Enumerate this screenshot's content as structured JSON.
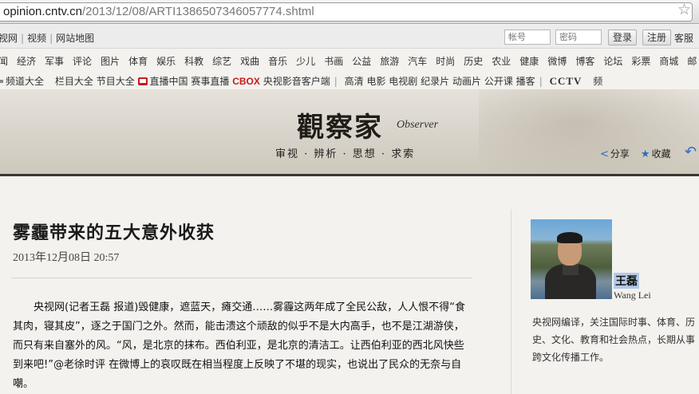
{
  "browser": {
    "url_host": "opinion.cntv.cn",
    "url_path": "/2013/12/08/ARTI1386507346057774.shtml",
    "bookmark_icon": "star-icon"
  },
  "topbar": {
    "links": [
      "视网",
      "视频",
      "网站地图"
    ],
    "username_placeholder": "帐号",
    "password_placeholder": "密码",
    "login_label": "登录",
    "register_label": "注册",
    "service_label": "客服"
  },
  "nav": {
    "row1": [
      "闻",
      "经济",
      "军事",
      "评论",
      "图片",
      "体育",
      "娱乐",
      "科教",
      "综艺",
      "戏曲",
      "音乐",
      "少儿",
      "书画",
      "公益",
      "旅游",
      "汽车",
      "时尚",
      "历史",
      "农业",
      "健康",
      "微博",
      "博客",
      "论坛",
      "彩票",
      "商城",
      "邮"
    ],
    "row2": {
      "channels": "频道大全",
      "columns": "栏目大全",
      "programs": "节目大全",
      "live_china": "直播中国",
      "event_live": "赛事直播",
      "cbox": "CBOX",
      "cbox_client": "央视影音客户端",
      "hd": "高清",
      "movie": "电影",
      "tv_drama": "电视剧",
      "documentary": "纪录片",
      "animation": "动画片",
      "open_course": "公开课",
      "broadcaster": "播客",
      "cctv": "CCTV",
      "more": "频"
    }
  },
  "banner": {
    "logo_cn": "觀察家",
    "logo_en": "Observer",
    "slogan": "审视 · 辨析 · 思想 · 求索",
    "share_label": "分享",
    "favorite_label": "收藏"
  },
  "article": {
    "title": "雾霾带来的五大意外收获",
    "datetime": "2013年12月08日 20:57",
    "body": "央视网(记者王磊 报道)毁健康，遮蓝天，瘫交通……雾霾这两年成了全民公敌，人人恨不得“食其肉，寝其皮”，逐之于国门之外。然而，能击溃这个顽敌的似乎不是大内高手，也不是江湖游侠，而只有来自塞外的风。“风，是北京的抹布。西伯利亚，是北京的清洁工。让西伯利亚的西北风快些到来吧!”@老徐时评 在微博上的哀叹既在相当程度上反映了不堪的现实，也说出了民众的无奈与自嘲。"
  },
  "author": {
    "name": "王磊",
    "name_en": "Wang Lei",
    "bio": "央视网编译，关注国际时事、体育、历史、文化、教育和社会热点，长期从事跨文化传播工作。"
  },
  "colors": {
    "accent_blue": "#2b6cc4",
    "brand_red": "#c91a1a",
    "banner_rule": "#3a3631"
  }
}
